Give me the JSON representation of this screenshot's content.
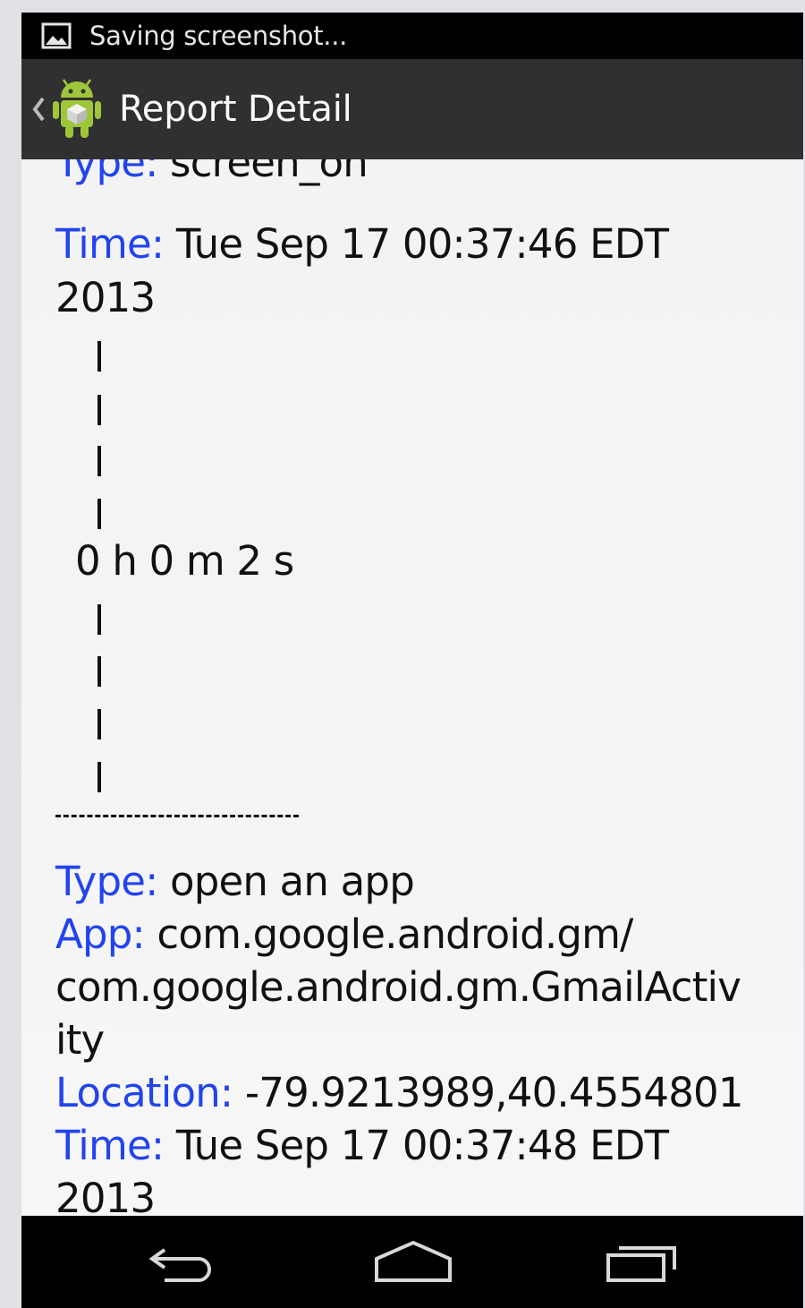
{
  "status_bar": {
    "text": "Saving screenshot..."
  },
  "action_bar": {
    "title": "Report Detail"
  },
  "report": {
    "cut_top": {
      "label": "Type:",
      "value": "screen_on"
    },
    "event1_time": {
      "label": "Time:",
      "value": "Tue Sep 17 00:37:46 EDT",
      "value_cont": "2013"
    },
    "duration": "0 h 0 m 2 s",
    "separator": "--------------------",
    "event2_type": {
      "label": "Type:",
      "value": "open an app"
    },
    "event2_app": {
      "label": "App:",
      "value": "com.google.android.gm/",
      "value_cont1": "com.google.android.gm.GmailActiv",
      "value_cont2": "ity"
    },
    "event2_location": {
      "label": "Location:",
      "value": "-79.9213989,40.4554801"
    },
    "event2_time": {
      "label": "Time:",
      "value": "Tue Sep 17 00:37:48 EDT",
      "value_cont": "2013"
    }
  },
  "nav_bar": {
    "back": "back-icon",
    "home": "home-icon",
    "recents": "recents-icon"
  },
  "colors": {
    "label": "#2244ee",
    "text": "#111111",
    "action_bar": "#303030",
    "status_bar": "#000000"
  }
}
